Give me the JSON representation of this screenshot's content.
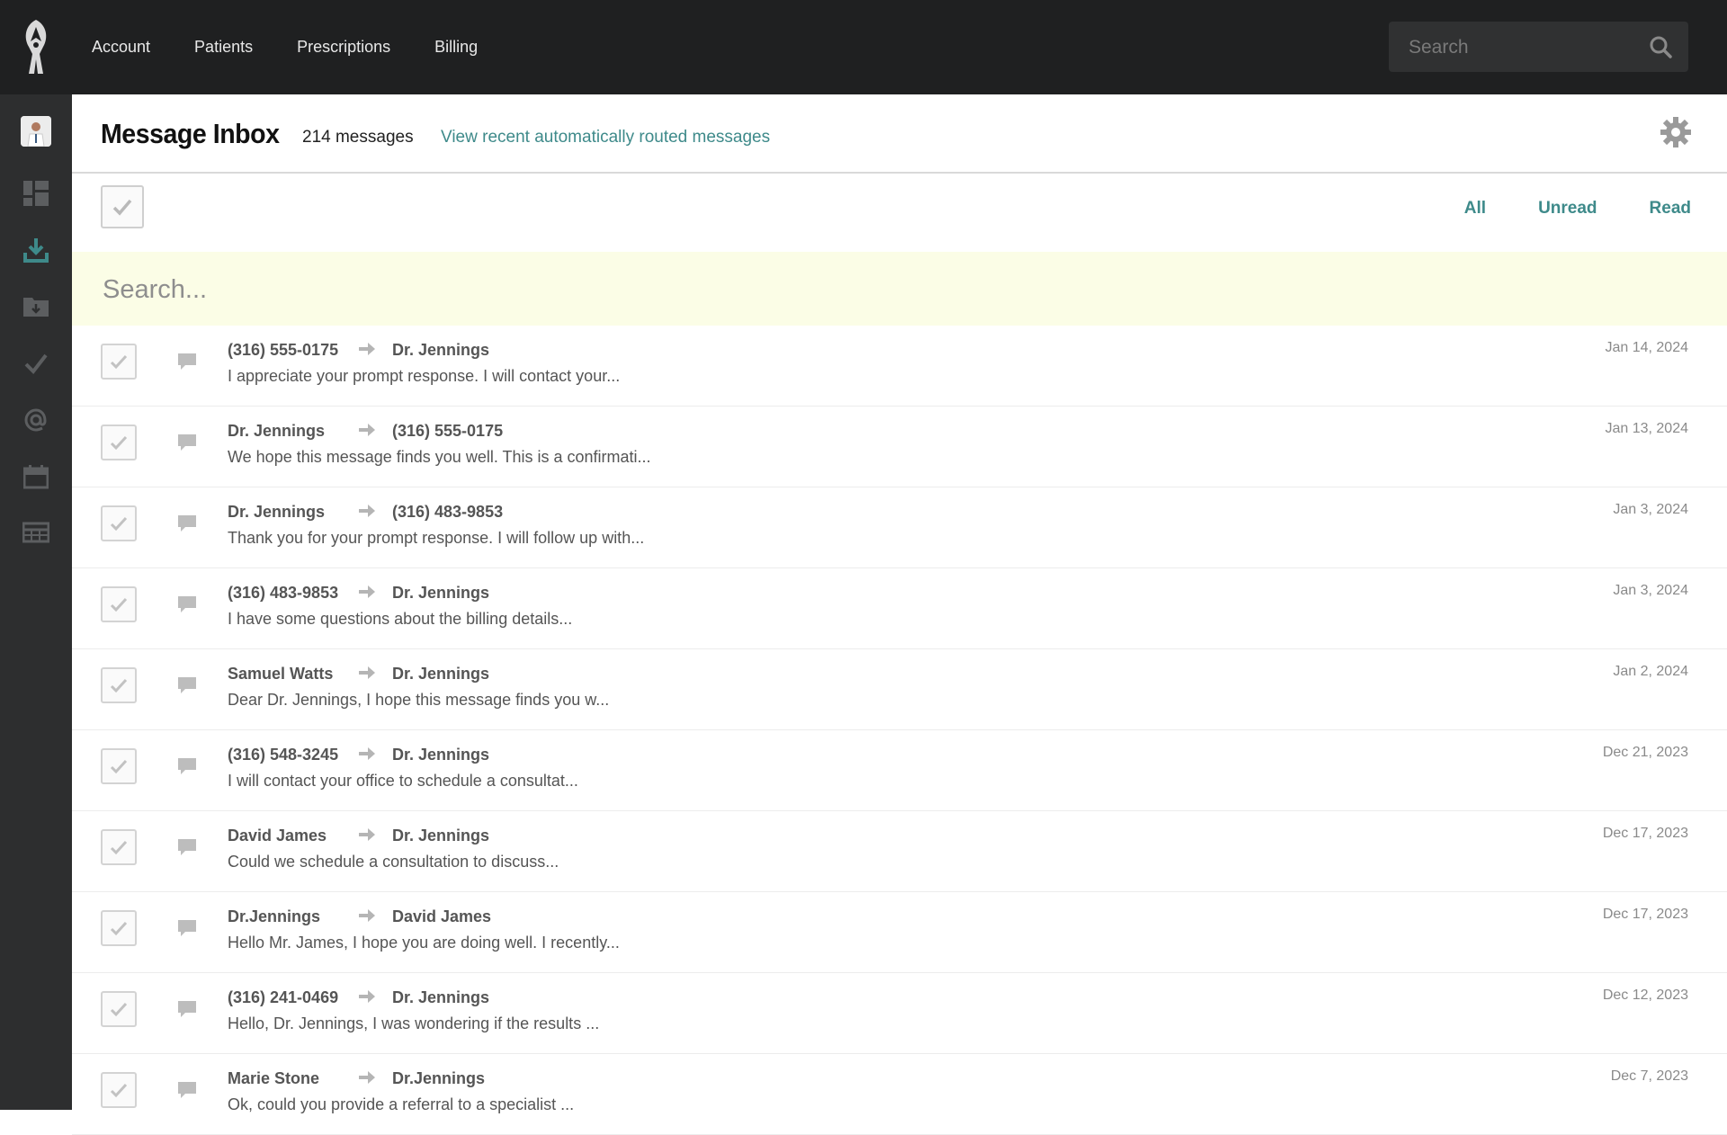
{
  "topbar": {
    "nav": [
      "Account",
      "Patients",
      "Prescriptions",
      "Billing"
    ],
    "search_placeholder": "Search"
  },
  "header": {
    "title": "Message Inbox",
    "count": "214 messages",
    "routed_link": "View recent automatically routed messages"
  },
  "filters": [
    "All",
    "Unread",
    "Read"
  ],
  "search": {
    "placeholder": "Search..."
  },
  "colors": {
    "accent": "#3e8a8a",
    "topbar": "#1f2021",
    "sidebar": "#2d2e2f",
    "search_bg": "#fbfde6"
  },
  "sidebar_icons": [
    "avatar",
    "dashboard-icon",
    "download-icon",
    "folder-icon",
    "checkmark-icon",
    "at-icon",
    "calendar-icon",
    "table-icon"
  ],
  "messages": [
    {
      "from": "(316) 555-0175",
      "to": "Dr. Jennings",
      "preview": "I appreciate your prompt response. I will contact your...",
      "date": "Jan 14, 2024"
    },
    {
      "from": "Dr. Jennings",
      "to": "(316) 555-0175",
      "preview": "We hope this message finds you well. This is a confirmati...",
      "date": "Jan 13, 2024"
    },
    {
      "from": "Dr. Jennings",
      "to": "(316) 483-9853",
      "preview": "Thank you for your prompt response. I will follow up with...",
      "date": "Jan 3, 2024"
    },
    {
      "from": "(316) 483-9853",
      "to": "Dr. Jennings",
      "preview": "I have some questions about the billing details...",
      "date": "Jan 3, 2024"
    },
    {
      "from": "Samuel Watts",
      "to": "Dr. Jennings",
      "preview": "Dear Dr. Jennings, I hope this message finds you w...",
      "date": "Jan 2, 2024"
    },
    {
      "from": "(316) 548-3245",
      "to": "Dr. Jennings",
      "preview": "I will contact your office to schedule a consultat...",
      "date": "Dec 21, 2023"
    },
    {
      "from": "David James",
      "to": "Dr. Jennings",
      "preview": "Could we schedule a consultation to discuss...",
      "date": "Dec 17, 2023"
    },
    {
      "from": "Dr.Jennings",
      "to": "David James",
      "preview": "Hello Mr. James, I hope you are doing well. I recently...",
      "date": "Dec 17, 2023"
    },
    {
      "from": "(316) 241-0469",
      "to": "Dr. Jennings",
      "preview": "Hello, Dr. Jennings, I was wondering if the results ...",
      "date": "Dec 12, 2023"
    },
    {
      "from": "Marie Stone",
      "to": "Dr.Jennings",
      "preview": "Ok, could you provide a referral to a specialist ...",
      "date": "Dec 7, 2023"
    }
  ]
}
